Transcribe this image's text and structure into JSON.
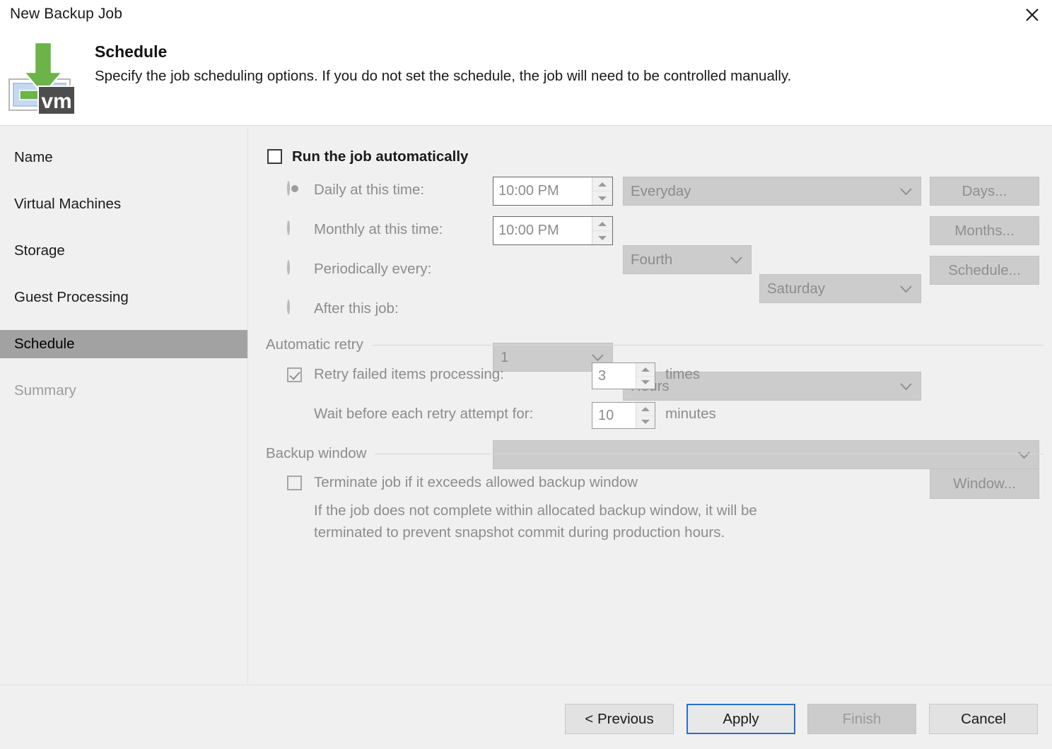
{
  "window": {
    "title": "New Backup Job",
    "close_icon": "close-icon"
  },
  "header": {
    "title": "Schedule",
    "subtitle": "Specify the job scheduling options. If you do not set the schedule, the job will need to be controlled manually.",
    "icon": "vm-backup-icon"
  },
  "sidebar": {
    "items": [
      {
        "label": "Name",
        "state": "enabled"
      },
      {
        "label": "Virtual Machines",
        "state": "enabled"
      },
      {
        "label": "Storage",
        "state": "enabled"
      },
      {
        "label": "Guest Processing",
        "state": "enabled"
      },
      {
        "label": "Schedule",
        "state": "active"
      },
      {
        "label": "Summary",
        "state": "disabled"
      }
    ]
  },
  "main": {
    "run_automatically": {
      "label": "Run the job automatically",
      "checked": false
    },
    "schedule_options": {
      "daily": {
        "label": "Daily at this time:",
        "selected": true,
        "time": "10:00 PM",
        "frequency": "Everyday",
        "button": "Days..."
      },
      "monthly": {
        "label": "Monthly at this time:",
        "selected": false,
        "time": "10:00 PM",
        "week": "Fourth",
        "day": "Saturday",
        "button": "Months..."
      },
      "periodically": {
        "label": "Periodically every:",
        "selected": false,
        "interval": "1",
        "unit": "Hours",
        "button": "Schedule..."
      },
      "after_job": {
        "label": "After this job:",
        "selected": false,
        "value": ""
      }
    },
    "automatic_retry": {
      "group_label": "Automatic retry",
      "retry_checkbox": {
        "label": "Retry failed items processing:",
        "checked": true
      },
      "retry_count": "3",
      "retry_count_unit": "times",
      "wait_label": "Wait before each retry attempt for:",
      "wait_value": "10",
      "wait_unit": "minutes"
    },
    "backup_window": {
      "group_label": "Backup window",
      "terminate_checkbox": {
        "label": "Terminate job if it exceeds allowed backup window",
        "checked": false
      },
      "window_button": "Window...",
      "description_line1": "If the job does not complete within allocated backup window, it will be",
      "description_line2": "terminated to prevent snapshot commit during production hours."
    }
  },
  "footer": {
    "previous": "< Previous",
    "apply": "Apply",
    "finish": "Finish",
    "cancel": "Cancel"
  },
  "colors": {
    "accent_focus": "#2a6fc9",
    "active_nav": "#a2a2a2",
    "icon_green": "#6cb34a",
    "vm_dark": "#4d4d4d",
    "window_bg": "#f0f0f0"
  }
}
